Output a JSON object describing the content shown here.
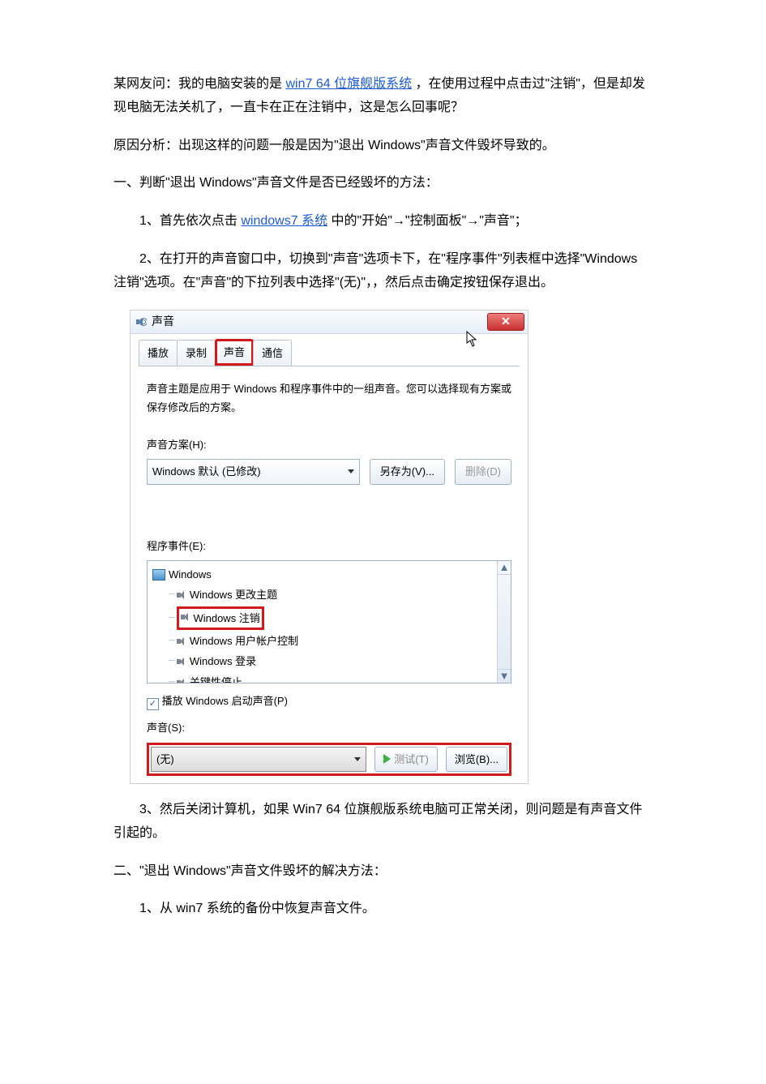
{
  "para1_a": "某网友问：我的电脑安装的是",
  "para1_link": "win7 64 位旗舰版系统",
  "para1_b": "，在使用过程中点击过\"注销\"，但是却发现电脑无法关机了，一直卡在正在注销中，这是怎么回事呢？",
  "para2": "原因分析：出现这样的问题一般是因为\"退出 Windows\"声音文件毁坏导致的。",
  "para3": "一、判断\"退出 Windows\"声音文件是否已经毁坏的方法：",
  "step1_a": "1、首先依次点击",
  "step1_link": "windows7 系统",
  "step1_b": "中的\"开始\"→\"控制面板\"→\"声音\"；",
  "step2": "2、在打开的声音窗口中，切换到\"声音\"选项卡下，在\"程序事件\"列表框中选择\"Windows 注销\"选项。在\"声音\"的下拉列表中选择\"(无)\"，，然后点击确定按钮保存退出。",
  "dialog": {
    "title": "声音",
    "tabs": [
      "播放",
      "录制",
      "声音",
      "通信"
    ],
    "active_tab_index": 2,
    "description": "声音主题是应用于 Windows 和程序事件中的一组声音。您可以选择现有方案或保存修改后的方案。",
    "scheme_label": "声音方案(H):",
    "scheme_value": "Windows 默认 (已修改)",
    "save_as": "另存为(V)...",
    "delete": "删除(D)",
    "events_label": "程序事件(E):",
    "events_root": "Windows",
    "events": [
      "Windows 更改主题",
      "Windows 注销",
      "Windows 用户帐户控制",
      "Windows 登录",
      "关键性停止"
    ],
    "selected_event_index": 1,
    "play_startup": "播放 Windows 启动声音(P)",
    "sound_label": "声音(S):",
    "sound_value": "(无)",
    "test_btn": "测试(T)",
    "browse_btn": "浏览(B)..."
  },
  "step3": "3、然后关闭计算机，如果 Win7 64 位旗舰版系统电脑可正常关闭，则问题是有声音文件引起的。",
  "sec2": "二、\"退出 Windows\"声音文件毁坏的解决方法：",
  "step21": "1、从 win7 系统的备份中恢复声音文件。"
}
